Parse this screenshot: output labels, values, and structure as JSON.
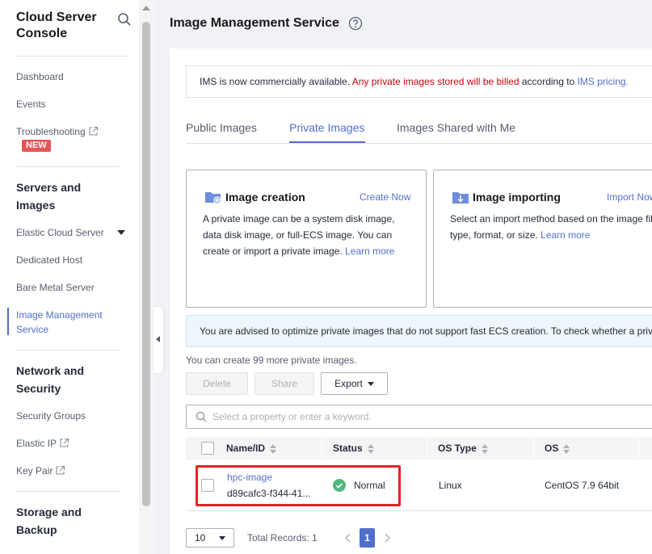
{
  "sidebar": {
    "title": "Cloud Server Console",
    "items": [
      {
        "label": "Dashboard"
      },
      {
        "label": "Events"
      },
      {
        "label": "Troubleshooting",
        "badge": "NEW"
      }
    ],
    "groups": [
      {
        "label": "Servers and Images",
        "items": [
          "Elastic Cloud Server",
          "Dedicated Host",
          "Bare Metal Server",
          "Image Management Service"
        ]
      },
      {
        "label": "Network and Security",
        "items": [
          "Security Groups",
          "Elastic IP",
          "Key Pair"
        ]
      },
      {
        "label": "Storage and Backup"
      }
    ],
    "active_item": "Image Management Service"
  },
  "header": {
    "title": "Image Management Service"
  },
  "notice": {
    "text1": "IMS is now commercially available.",
    "warn": "Any private images stored will be billed",
    "text2": "according to",
    "link": "IMS pricing."
  },
  "tabs": [
    {
      "label": "Public Images"
    },
    {
      "label": "Private Images",
      "active": true
    },
    {
      "label": "Images Shared with Me"
    }
  ],
  "cards": [
    {
      "title": "Image creation",
      "action": "Create Now",
      "desc": "A private image can be a system disk image, data disk image, or full-ECS image. You can create or import a private image.",
      "link": "Learn more"
    },
    {
      "title": "Image importing",
      "action": "Import Now",
      "desc": "Select an import method based on the image file type, format, or size.",
      "link": "Learn more"
    }
  ],
  "advice": "You are advised to optimize private images that do not support fast ECS creation. To check whether a private",
  "quota": "You can create 99 more private images.",
  "toolbar": {
    "delete_label": "Delete",
    "share_label": "Share",
    "export_label": "Export"
  },
  "search": {
    "placeholder": "Select a property or enter a keyword."
  },
  "table": {
    "columns": [
      "Name/ID",
      "Status",
      "OS Type",
      "OS"
    ],
    "rows": [
      {
        "name": "hpc-image",
        "id": "d89cafc3-f344-41...",
        "status": "Normal",
        "os_type": "Linux",
        "os": "CentOS 7.9 64bit"
      }
    ]
  },
  "pagination": {
    "page_size": "10",
    "total": "Total Records: 1",
    "current": "1"
  },
  "colors": {
    "accent": "#526ecc",
    "warn": "#c7000b",
    "status_ok": "#50b87f",
    "highlight": "#e12424",
    "new_badge": "#e6555a"
  }
}
